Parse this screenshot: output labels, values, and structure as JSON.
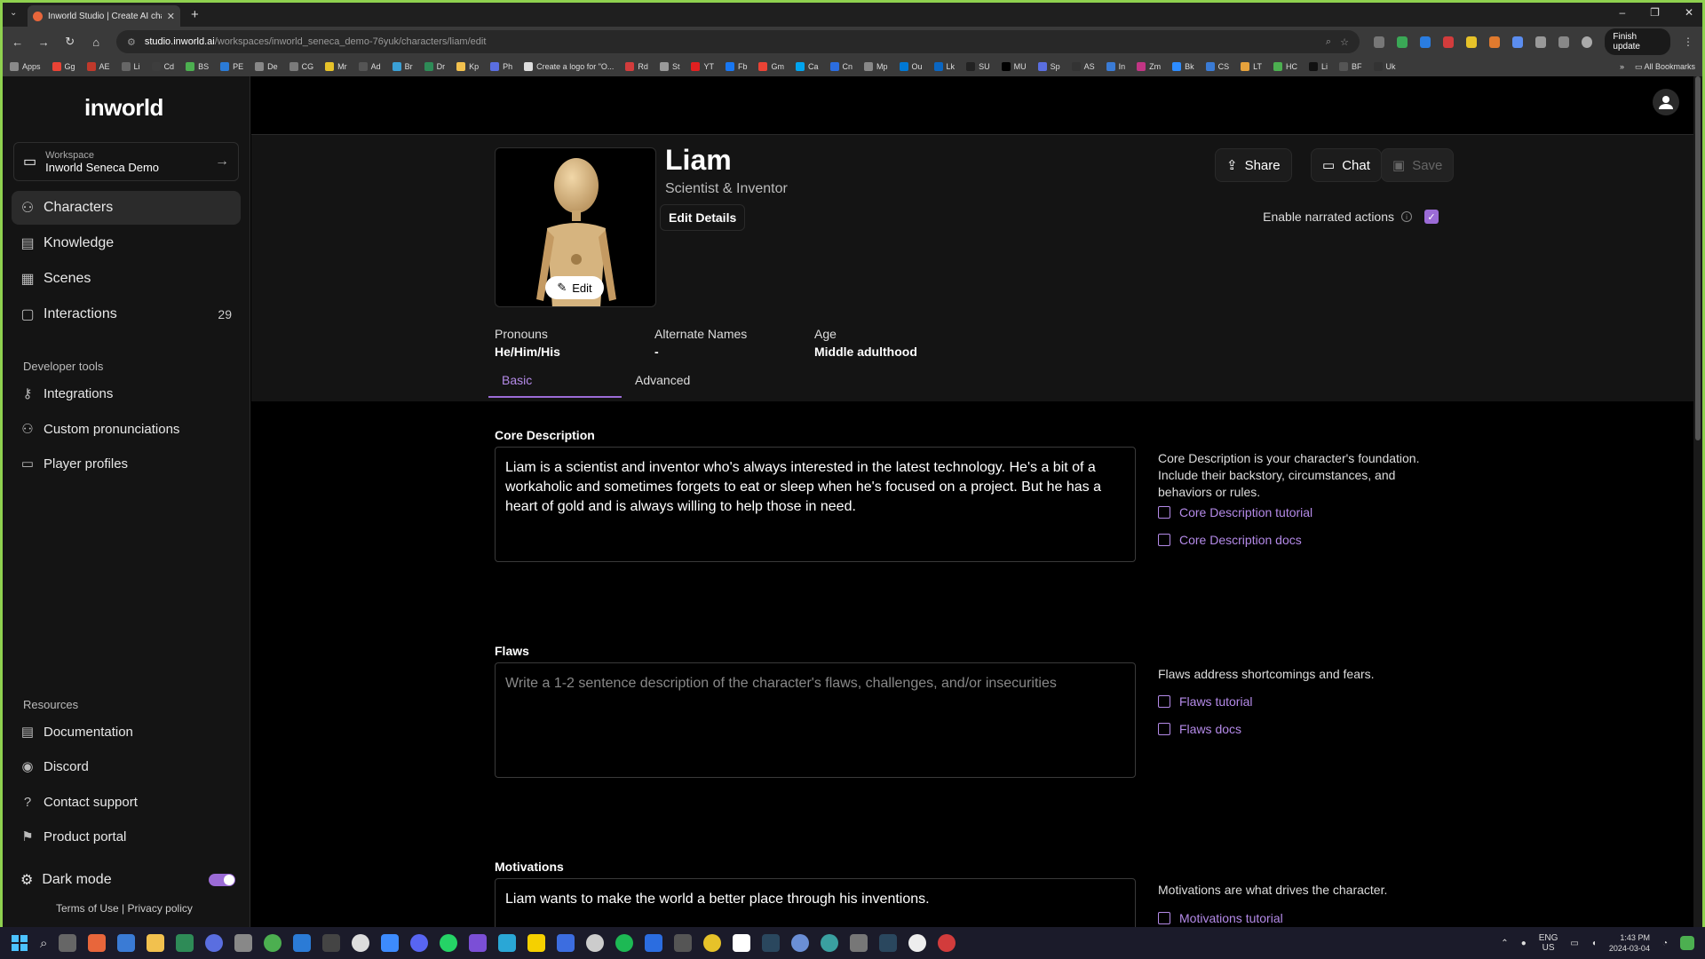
{
  "browser": {
    "tab_title": "Inworld Studio | Create AI chara",
    "url_host": "studio.inworld.ai",
    "url_path": "/workspaces/inworld_seneca_demo-76yuk/characters/liam/edit",
    "finish_update": "Finish update",
    "bookmarks": [
      "Apps",
      "Gg",
      "AE",
      "Li",
      "Cd",
      "BS",
      "PE",
      "De",
      "CG",
      "Mr",
      "Ad",
      "Br",
      "Dr",
      "Kp",
      "Ph",
      "Create a logo for \"O...",
      "Rd",
      "St",
      "YT",
      "Fb",
      "Gm",
      "Ca",
      "Cn",
      "Mp",
      "Ou",
      "Lk",
      "SU",
      "MU",
      "Sp",
      "AS",
      "In",
      "Zm",
      "Bk",
      "CS",
      "LT",
      "HC",
      "Li",
      "BF",
      "Uk"
    ],
    "all_bookmarks": "All Bookmarks"
  },
  "sidebar": {
    "logo": "inworld",
    "workspace_label": "Workspace",
    "workspace_name": "Inworld Seneca Demo",
    "items": [
      {
        "label": "Characters"
      },
      {
        "label": "Knowledge"
      },
      {
        "label": "Scenes"
      },
      {
        "label": "Interactions",
        "count": "29"
      }
    ],
    "dev_tools_label": "Developer tools",
    "dev_items": [
      {
        "label": "Integrations"
      },
      {
        "label": "Custom pronunciations"
      },
      {
        "label": "Player profiles"
      }
    ],
    "resources_label": "Resources",
    "resource_items": [
      {
        "label": "Documentation"
      },
      {
        "label": "Discord"
      },
      {
        "label": "Contact support"
      },
      {
        "label": "Product portal"
      }
    ],
    "dark_mode_label": "Dark mode",
    "terms": "Terms of Use",
    "separator": "|",
    "privacy": "Privacy policy"
  },
  "character": {
    "name": "Liam",
    "role": "Scientist & Inventor",
    "edit_label": "Edit",
    "edit_details": "Edit Details",
    "share": "Share",
    "chat": "Chat",
    "save": "Save",
    "narrated_actions": "Enable narrated actions",
    "pronouns_label": "Pronouns",
    "pronouns_value": "He/Him/His",
    "alt_names_label": "Alternate Names",
    "alt_names_value": "-",
    "age_label": "Age",
    "age_value": "Middle adulthood"
  },
  "tabs": [
    {
      "label": "Basic"
    },
    {
      "label": "Advanced"
    }
  ],
  "fields": {
    "core": {
      "label": "Core Description",
      "value": "Liam is a scientist and inventor who's always interested in the latest technology. He's a bit of a workaholic and sometimes forgets to eat or sleep when he's focused on a project. But he has a heart of gold and is always willing to help those in need.",
      "help": "Core Description is your character's foundation. Include their backstory, circumstances, and behaviors or rules.",
      "tutorial": "Core Description tutorial",
      "docs": "Core Description docs"
    },
    "flaws": {
      "label": "Flaws",
      "placeholder": "Write a 1-2 sentence description of the character's flaws, challenges, and/or insecurities",
      "help": "Flaws address shortcomings and fears.",
      "tutorial": "Flaws tutorial",
      "docs": "Flaws docs"
    },
    "motivations": {
      "label": "Motivations",
      "value": "Liam wants to make the world a better place through his inventions.",
      "help": "Motivations are what drives the character.",
      "tutorial": "Motivations tutorial"
    }
  },
  "taskbar": {
    "lang": "ENG",
    "region": "US",
    "time": "1:43 PM",
    "date": "2024-03-04"
  },
  "colors": {
    "accent": "#9b6bd6",
    "frame": "#8fd14f"
  }
}
